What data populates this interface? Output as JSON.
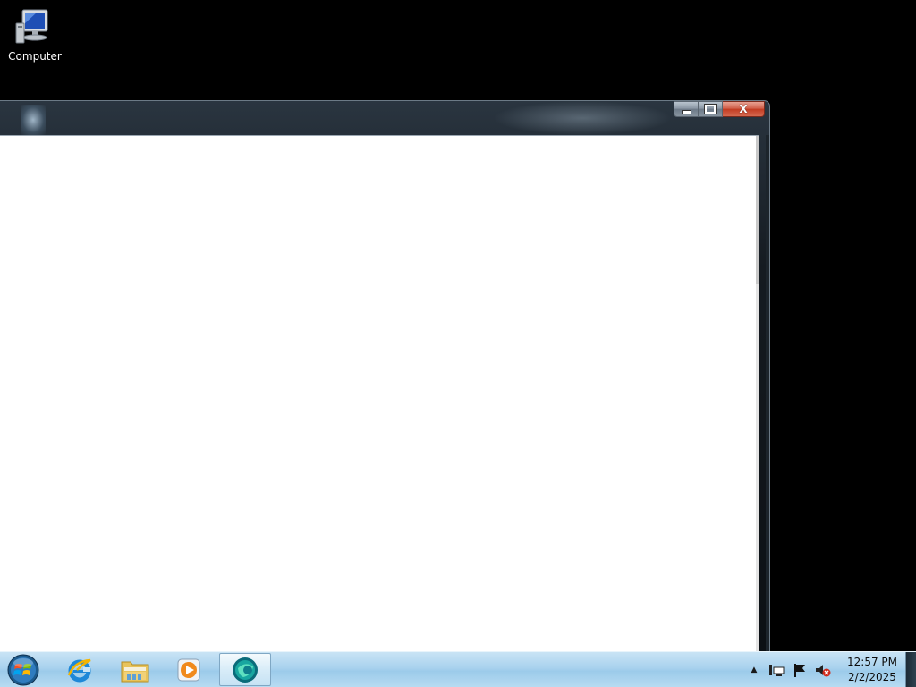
{
  "desktop": {
    "icons": [
      {
        "label": "Computer",
        "icon": "computer-icon"
      }
    ]
  },
  "window": {
    "caption_buttons": {
      "minimize": "minimize-icon",
      "maximize": "maximize-icon",
      "close": "close-icon",
      "close_glyph": "X"
    }
  },
  "taskbar": {
    "start": "windows-start-orb-icon",
    "pinned": [
      {
        "icon": "internet-explorer-icon"
      },
      {
        "icon": "windows-explorer-folder-icon"
      },
      {
        "icon": "windows-media-player-icon"
      },
      {
        "icon": "browser-app-icon",
        "active": true
      }
    ],
    "tray": {
      "chevron": "▲",
      "icons": [
        "network-icon",
        "action-center-flag-icon",
        "volume-muted-icon"
      ],
      "time": "12:57 PM",
      "date": "2/2/2025"
    }
  },
  "colors": {
    "taskbar": "#a9d2ee",
    "window_frame": "#151b21",
    "close_button": "#c23b22",
    "client_bg": "#ffffff"
  }
}
